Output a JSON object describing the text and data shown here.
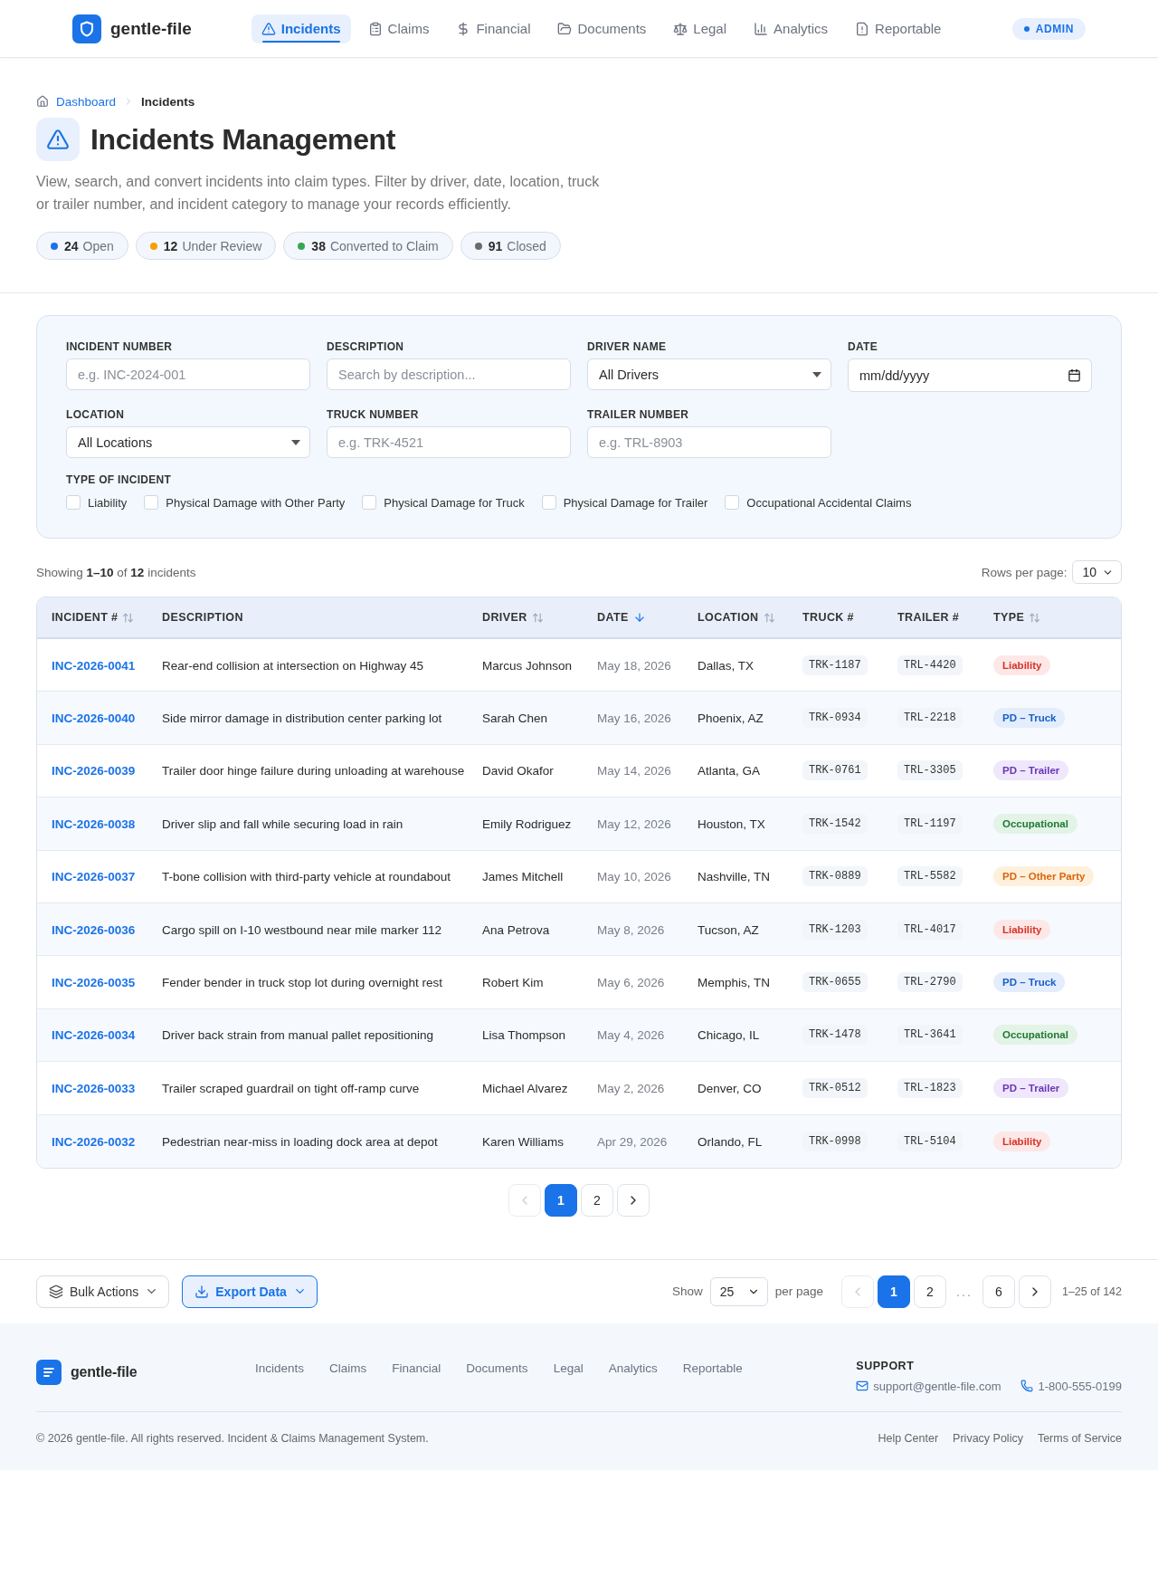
{
  "header": {
    "brand": "gentle-file",
    "nav": [
      {
        "label": "Incidents",
        "selected": true
      },
      {
        "label": "Claims",
        "selected": false
      },
      {
        "label": "Financial",
        "selected": false
      },
      {
        "label": "Documents",
        "selected": false
      },
      {
        "label": "Legal",
        "selected": false
      },
      {
        "label": "Analytics",
        "selected": false
      },
      {
        "label": "Reportable",
        "selected": false
      }
    ],
    "role_badge": "ADMIN"
  },
  "breadcrumb": [
    {
      "label": "Dashboard",
      "current": false
    },
    {
      "label": "Incidents",
      "current": true
    }
  ],
  "page": {
    "title": "Incidents Management",
    "description": "View, search, and convert incidents into claim types. Filter by driver, date, location, truck or trailer number, and incident category to manage your records efficiently."
  },
  "status_counts": [
    {
      "count": "24",
      "label": "Open",
      "color": "#1a73e8"
    },
    {
      "count": "12",
      "label": "Under Review",
      "color": "#f5a000"
    },
    {
      "count": "38",
      "label": "Converted to Claim",
      "color": "#34a853"
    },
    {
      "count": "91",
      "label": "Closed",
      "color": "#6b6b6b"
    }
  ],
  "filters": {
    "fields": [
      {
        "label": "INCIDENT NUMBER",
        "kind": "text",
        "placeholder": "e.g. INC-2024-001"
      },
      {
        "label": "DESCRIPTION",
        "kind": "text",
        "placeholder": "Search by description..."
      },
      {
        "label": "DRIVER NAME",
        "kind": "select",
        "value": "All Drivers"
      },
      {
        "label": "DATE",
        "kind": "date",
        "placeholder": "mm/dd/yyyy"
      },
      {
        "label": "LOCATION",
        "kind": "select",
        "value": "All Locations"
      },
      {
        "label": "TRUCK NUMBER",
        "kind": "text",
        "placeholder": "e.g. TRK-4521"
      },
      {
        "label": "TRAILER NUMBER",
        "kind": "text",
        "placeholder": "e.g. TRL-8903"
      }
    ],
    "incident_types": {
      "label": "TYPE OF INCIDENT",
      "options": [
        {
          "label": "Liability",
          "checked": false
        },
        {
          "label": "Physical Damage with Other Party",
          "checked": false
        },
        {
          "label": "Physical Damage for Truck",
          "checked": false
        },
        {
          "label": "Physical Damage for Trailer",
          "checked": false
        },
        {
          "label": "Occupational Accidental Claims",
          "checked": false
        }
      ]
    }
  },
  "results": {
    "summary": "Showing **1–10** of **12** incidents",
    "rows_per_page_label": "Rows per page:",
    "rows_per_page": "10"
  },
  "table": {
    "columns": [
      {
        "label": "INCIDENT #",
        "sortable": true,
        "active": false
      },
      {
        "label": "DESCRIPTION"
      },
      {
        "label": "DRIVER",
        "sortable": true,
        "active": false
      },
      {
        "label": "DATE",
        "sortable": true,
        "active": true
      },
      {
        "label": "LOCATION",
        "sortable": true,
        "active": false
      },
      {
        "label": "TRUCK #"
      },
      {
        "label": "TRAILER #"
      },
      {
        "label": "TYPE",
        "sortable": true,
        "active": false
      }
    ],
    "rows": [
      {
        "incident": "INC-2026-0041",
        "description": "Rear-end collision at intersection on Highway 45",
        "driver": "Marcus Johnson",
        "date": "May 18, 2026",
        "location": "Dallas, TX",
        "truck": "TRK-1187",
        "trailer": "TRL-4420",
        "type": {
          "label": "Liability",
          "kind": "liability"
        }
      },
      {
        "incident": "INC-2026-0040",
        "description": "Side mirror damage in distribution center parking lot",
        "driver": "Sarah Chen",
        "date": "May 16, 2026",
        "location": "Phoenix, AZ",
        "truck": "TRK-0934",
        "trailer": "TRL-2218",
        "type": {
          "label": "PD – Truck",
          "kind": "pd_truck"
        }
      },
      {
        "incident": "INC-2026-0039",
        "description": "Trailer door hinge failure during unloading at warehouse",
        "driver": "David Okafor",
        "date": "May 14, 2026",
        "location": "Atlanta, GA",
        "truck": "TRK-0761",
        "trailer": "TRL-3305",
        "type": {
          "label": "PD – Trailer",
          "kind": "pd_trailer"
        }
      },
      {
        "incident": "INC-2026-0038",
        "description": "Driver slip and fall while securing load in rain",
        "driver": "Emily Rodriguez",
        "date": "May 12, 2026",
        "location": "Houston, TX",
        "truck": "TRK-1542",
        "trailer": "TRL-1197",
        "type": {
          "label": "Occupational",
          "kind": "occupational"
        }
      },
      {
        "incident": "INC-2026-0037",
        "description": "T-bone collision with third-party vehicle at roundabout",
        "driver": "James Mitchell",
        "date": "May 10, 2026",
        "location": "Nashville, TN",
        "truck": "TRK-0889",
        "trailer": "TRL-5582",
        "type": {
          "label": "PD – Other Party",
          "kind": "pd_other"
        }
      },
      {
        "incident": "INC-2026-0036",
        "description": "Cargo spill on I-10 westbound near mile marker 112",
        "driver": "Ana Petrova",
        "date": "May 8, 2026",
        "location": "Tucson, AZ",
        "truck": "TRK-1203",
        "trailer": "TRL-4017",
        "type": {
          "label": "Liability",
          "kind": "liability"
        }
      },
      {
        "incident": "INC-2026-0035",
        "description": "Fender bender in truck stop lot during overnight rest",
        "driver": "Robert Kim",
        "date": "May 6, 2026",
        "location": "Memphis, TN",
        "truck": "TRK-0655",
        "trailer": "TRL-2790",
        "type": {
          "label": "PD – Truck",
          "kind": "pd_truck"
        }
      },
      {
        "incident": "INC-2026-0034",
        "description": "Driver back strain from manual pallet repositioning",
        "driver": "Lisa Thompson",
        "date": "May 4, 2026",
        "location": "Chicago, IL",
        "truck": "TRK-1478",
        "trailer": "TRL-3641",
        "type": {
          "label": "Occupational",
          "kind": "occupational"
        }
      },
      {
        "incident": "INC-2026-0033",
        "description": "Trailer scraped guardrail on tight off-ramp curve",
        "driver": "Michael Alvarez",
        "date": "May 2, 2026",
        "location": "Denver, CO",
        "truck": "TRK-0512",
        "trailer": "TRL-1823",
        "type": {
          "label": "PD – Trailer",
          "kind": "pd_trailer"
        }
      },
      {
        "incident": "INC-2026-0032",
        "description": "Pedestrian near-miss in loading dock area at depot",
        "driver": "Karen Williams",
        "date": "Apr 29, 2026",
        "location": "Orlando, FL",
        "truck": "TRK-0998",
        "trailer": "TRL-5104",
        "type": {
          "label": "Liability",
          "kind": "liability"
        }
      }
    ]
  },
  "table_pagination": {
    "prev_disabled": true,
    "next_disabled": false,
    "pages": [
      {
        "label": "1",
        "selected": true
      },
      {
        "label": "2",
        "selected": false
      }
    ]
  },
  "bottom_bar": {
    "bulk_button": "Bulk Actions",
    "export_button": "Export Data",
    "show_label": "Show",
    "per_page": "25",
    "per_page_label": "per page",
    "prev_disabled": true,
    "next_disabled": false,
    "pages": [
      {
        "label": "1",
        "selected": true
      },
      {
        "label": "2",
        "selected": false
      }
    ],
    "gap": "...",
    "last_page": {
      "label": "6",
      "selected": false
    },
    "range": "1–25 of 142"
  },
  "footer": {
    "brand": "gentle-file",
    "links": [
      "Incidents",
      "Claims",
      "Financial",
      "Documents",
      "Legal",
      "Analytics",
      "Reportable"
    ],
    "support_heading": "SUPPORT",
    "email": "support@gentle-file.com",
    "phone": "1-800-555-0199",
    "copyright": "© 2026 gentle-file. All rights reserved. Incident & Claims Management System.",
    "legal_links": [
      "Help Center",
      "Privacy Policy",
      "Terms of Service"
    ]
  }
}
